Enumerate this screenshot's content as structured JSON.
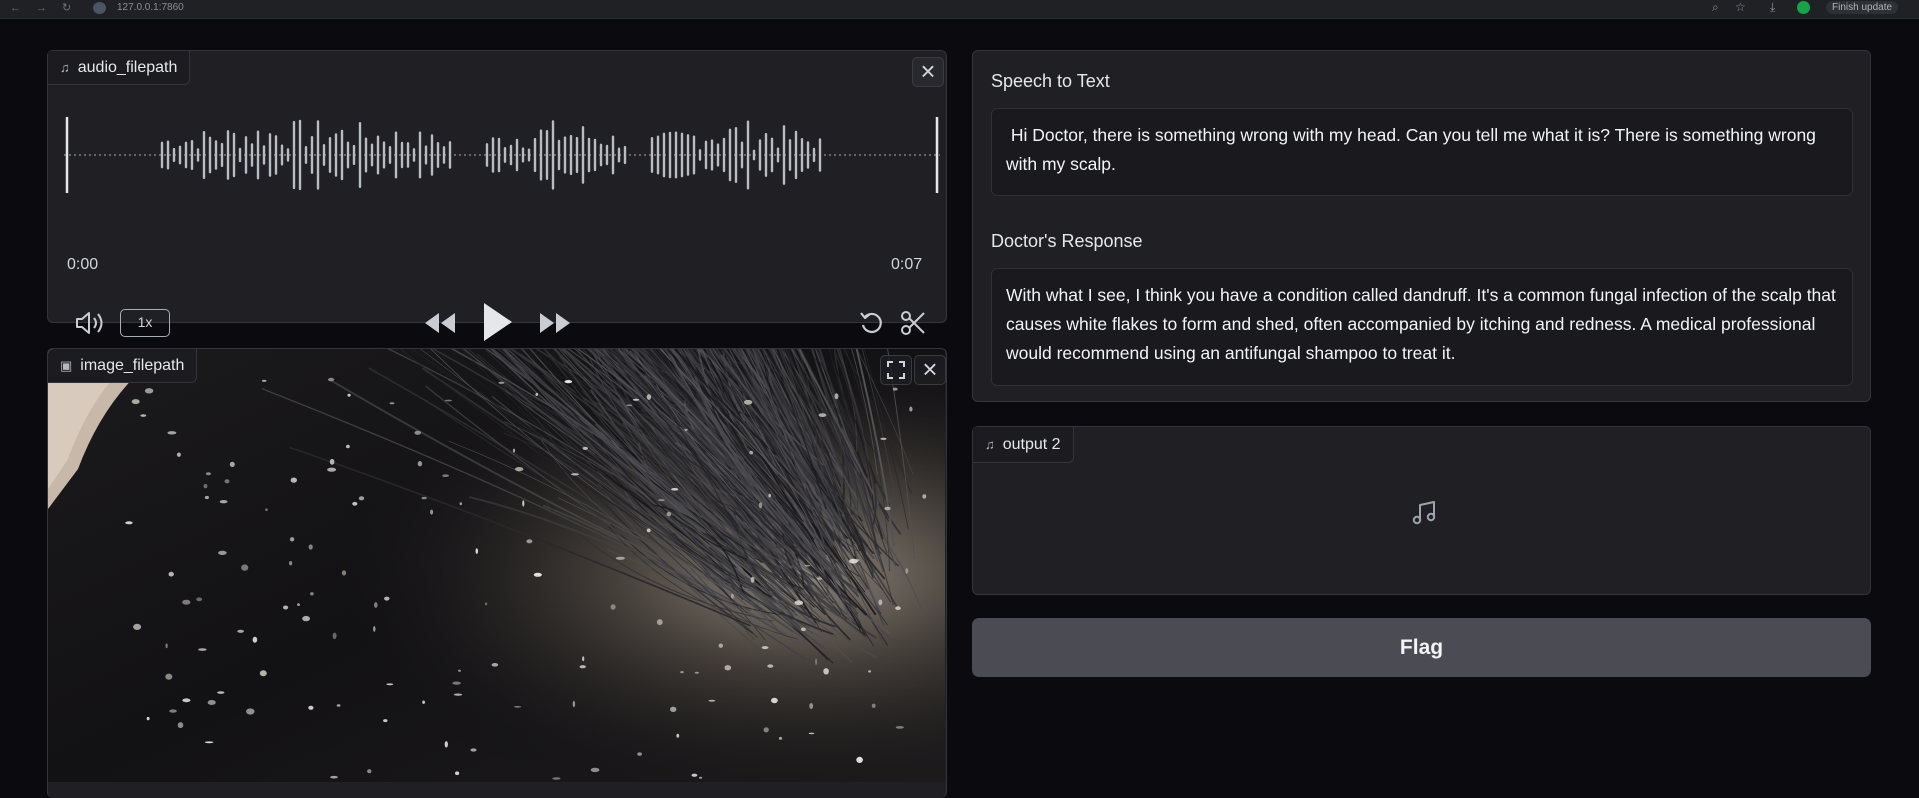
{
  "browser": {
    "url": "127.0.0.1:7860",
    "update_button": "Finish update",
    "icons": [
      "back-icon",
      "forward-icon",
      "reload-icon",
      "site-info-icon",
      "zoom-icon",
      "star-icon",
      "download-icon",
      "menu-icon"
    ]
  },
  "audio_input": {
    "label": "audio_filepath",
    "icon": "music-note-icon",
    "time_start": "0:00",
    "time_end": "0:07",
    "speed": "1x",
    "controls": [
      "volume-icon",
      "rewind-icon",
      "play-icon",
      "fast-forward-icon",
      "undo-icon",
      "trim-icon",
      "close-icon"
    ]
  },
  "image_input": {
    "label": "image_filepath",
    "icon": "image-icon",
    "controls": [
      "fullscreen-icon",
      "close-icon"
    ]
  },
  "outputs": {
    "speech_to_text": {
      "label": "Speech to Text",
      "value": " Hi Doctor, there is something wrong with my head. Can you tell me what it is? There is something wrong with my scalp."
    },
    "doctor_response": {
      "label": "Doctor's Response",
      "value": "With what I see, I think you have a condition called dandruff. It's a common fungal infection of the scalp that causes white flakes to form and shed, often accompanied by itching and redness. A medical professional would recommend using an antifungal shampoo to treat it."
    },
    "audio_output": {
      "label": "output 2",
      "icon": "music-note-icon",
      "placeholder_icon": "music-note-icon"
    }
  },
  "actions": {
    "flag_label": "Flag"
  },
  "colors": {
    "background": "#0b0b0f",
    "panel": "#202024",
    "border": "#34343b",
    "flag_button": "#4b4b53"
  }
}
